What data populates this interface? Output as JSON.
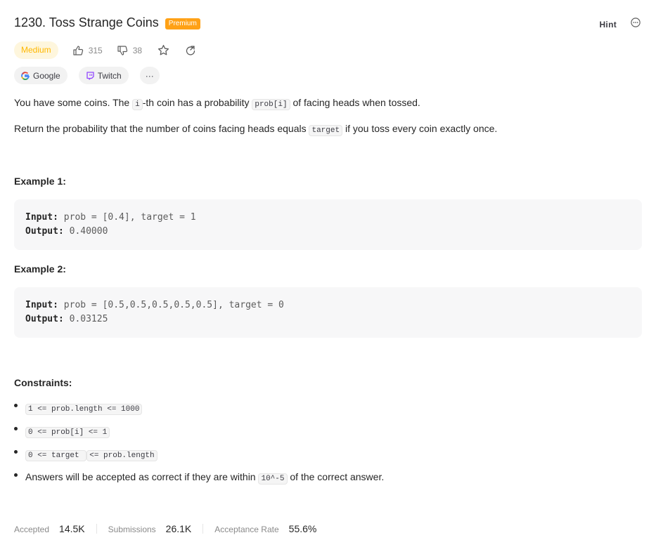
{
  "problem": {
    "title": "1230. Toss Strange Coins",
    "premium_label": "Premium",
    "difficulty": "Medium",
    "likes": "315",
    "dislikes": "38"
  },
  "toolbar": {
    "hint_label": "Hint"
  },
  "companies": [
    {
      "label": "Google"
    },
    {
      "label": "Twitch"
    }
  ],
  "more_tags_label": "···",
  "description": {
    "p1_a": "You have some coins.  The ",
    "p1_code1": "i",
    "p1_b": "-th coin has a probability ",
    "p1_code2": "prob[i]",
    "p1_c": " of facing heads when tossed.",
    "p2_a": "Return the probability that the number of coins facing heads equals ",
    "p2_code": "target",
    "p2_b": " if you toss every coin exactly once."
  },
  "examples": [
    {
      "heading": "Example 1:",
      "input_label": "Input:",
      "input": " prob = [0.4], target = 1",
      "output_label": "Output:",
      "output": " 0.40000"
    },
    {
      "heading": "Example 2:",
      "input_label": "Input:",
      "input": " prob = [0.5,0.5,0.5,0.5,0.5], target = 0",
      "output_label": "Output:",
      "output": " 0.03125"
    }
  ],
  "constraints": {
    "heading": "Constraints:",
    "c1": "1 <= prob.length <= 1000",
    "c2": "0 <= prob[i] <= 1",
    "c3a": "0 <= target ",
    "c3b": "<= prob.length",
    "c4_a": "Answers will be accepted as correct if they are within ",
    "c4_code": "10^-5",
    "c4_b": " of the correct answer."
  },
  "stats": {
    "accepted_label": "Accepted",
    "accepted": "14.5K",
    "submissions_label": "Submissions",
    "submissions": "26.1K",
    "rate_label": "Acceptance Rate",
    "rate": "55.6%"
  },
  "colors": {
    "premium": "#ffa116",
    "difficulty_medium": "#ffb800",
    "difficulty_bg": "#fef6dd",
    "twitch": "#9146ff"
  }
}
